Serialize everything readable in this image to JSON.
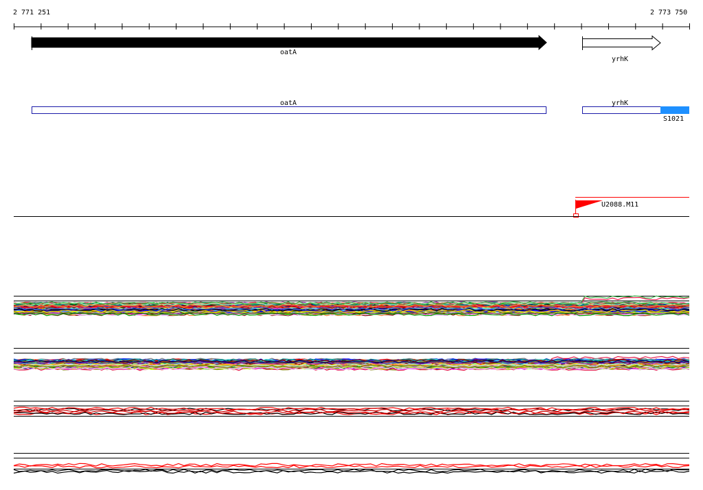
{
  "ruler": {
    "start_label": "2 771 251",
    "end_label": "2 773 750"
  },
  "genes": [
    {
      "name": "oatA",
      "strand": "+",
      "style": "filled"
    },
    {
      "name": "yrhK",
      "strand": "+",
      "style": "outline"
    }
  ],
  "features": [
    {
      "name": "oatA",
      "kind": "cds"
    },
    {
      "name": "yrhK",
      "kind": "cds"
    },
    {
      "name": "S1021",
      "kind": "region"
    }
  ],
  "marker": {
    "name": "U2088.M11"
  },
  "colors": {
    "gene_fill": "#000000",
    "feature_outline": "#1a1aa8",
    "feature_region": "#1e90ff",
    "marker": "#ff0000",
    "axis": "#000000"
  },
  "icons": {
    "marker": "red-flag-icon"
  }
}
